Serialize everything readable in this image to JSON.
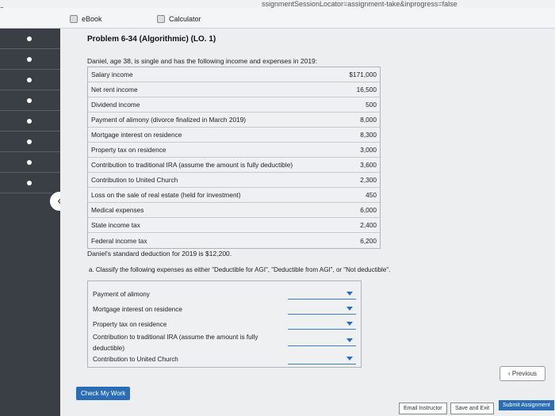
{
  "browser": {
    "url_fragment": "ssignmentSessionLocator=assignment-take&inprogress=false",
    "tab_corner_text": "s"
  },
  "tabs": [
    {
      "label": "eBook"
    },
    {
      "label": "Calculator"
    }
  ],
  "problem": {
    "title": "Problem 6-34 (Algorithmic) (LO. 1)",
    "intro": "Daniel, age 38, is single and has the following income and expenses in 2019:",
    "items": [
      {
        "label": "Salary income",
        "amount": "$171,000"
      },
      {
        "label": "Net rent income",
        "amount": "16,500"
      },
      {
        "label": "Dividend income",
        "amount": "500"
      },
      {
        "label": "Payment of alimony (divorce finalized in March 2019)",
        "amount": "8,000"
      },
      {
        "label": "Mortgage interest on residence",
        "amount": "8,300"
      },
      {
        "label": "Property tax on residence",
        "amount": "3,000"
      },
      {
        "label": "Contribution to traditional IRA (assume the amount is fully deductible)",
        "amount": "3,600"
      },
      {
        "label": "Contribution to United Church",
        "amount": "2,300"
      },
      {
        "label": "Loss on the sale of real estate (held for investment)",
        "amount": "450"
      },
      {
        "label": "Medical expenses",
        "amount": "6,000"
      },
      {
        "label": "State income tax",
        "amount": "2,400"
      },
      {
        "label": "Federal income tax",
        "amount": "6,200"
      }
    ],
    "standard_deduction": "Daniel's standard deduction for 2019 is $12,200.",
    "question_a": "a.  Classify the following expenses as either \"Deductible for AGI\", \"Deductible from AGI\", or \"Not deductible\".",
    "expenses": [
      {
        "label": "Payment of alimony",
        "value": ""
      },
      {
        "label": "Mortgage interest on residence",
        "value": ""
      },
      {
        "label": "Property tax on residence",
        "value": ""
      },
      {
        "label": "Contribution to traditional IRA (assume the amount is fully deductible)",
        "value": ""
      },
      {
        "label": "Contribution to United Church",
        "value": ""
      }
    ]
  },
  "buttons": {
    "check": "Check My Work",
    "previous": "Previous",
    "email": "Email Instructor",
    "save": "Save and Exit",
    "submit": "Submit Assignment"
  },
  "icons": {
    "star": "star-icon",
    "prev_arrow": "chevron-left-icon"
  },
  "colors": {
    "sidebar": "#3a3f45",
    "accent": "#2a6db5"
  }
}
